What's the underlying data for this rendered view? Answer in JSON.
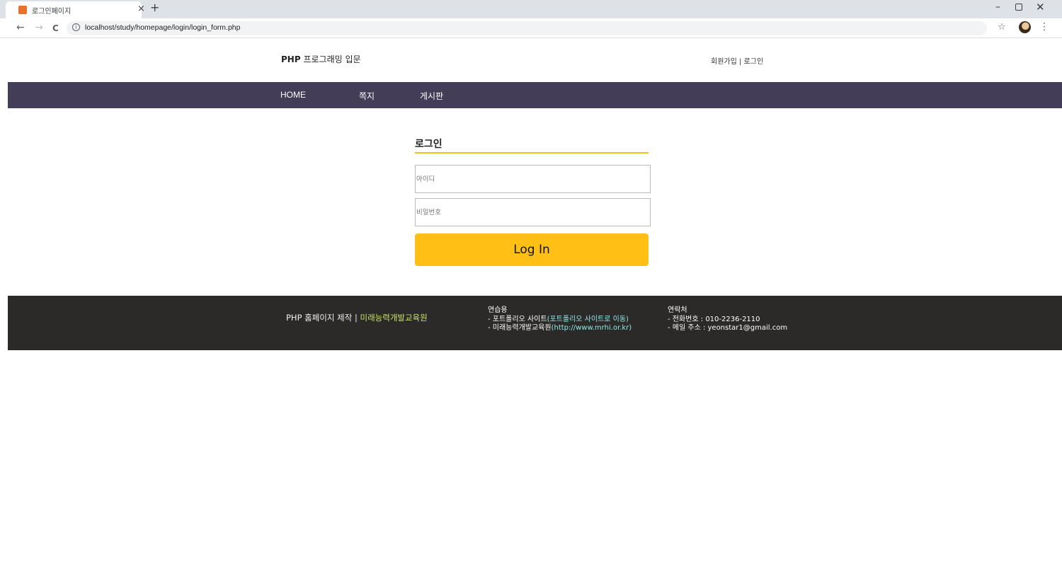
{
  "browser": {
    "tab_title": "로그인페이지",
    "tab_close": "×",
    "new_tab": "+",
    "url": "localhost/study/homepage/login/login_form.php",
    "back_glyph": "←",
    "forward_glyph": "→",
    "reload_glyph": "C",
    "info_glyph": "i",
    "star_glyph": "☆",
    "menu_glyph": "⋮",
    "min_glyph": "–",
    "close_glyph": "✕",
    "icons": [
      "back-arrow-icon",
      "forward-arrow-icon",
      "reload-icon",
      "info-icon",
      "star-icon",
      "profile-avatar",
      "kebab-menu-icon"
    ]
  },
  "header": {
    "site_title_bold": "PHP",
    "site_title_rest": " 프로그래밍 입문",
    "signup": "회원가입",
    "separator": " | ",
    "login": "로그인"
  },
  "menu": {
    "items": [
      "HOME",
      "쪽지",
      "게시판"
    ],
    "bg_color": "#433d57"
  },
  "login": {
    "title": "로그인",
    "id_placeholder": "아이디",
    "pw_placeholder": "비밀번호",
    "button": "Log In",
    "accent_color": "#ffbf15"
  },
  "footer": {
    "main": "PHP 홈페이지 제작 | ",
    "main_accent": "미래능력개발교육원",
    "col1": {
      "heading": "연습용",
      "line1": "- 포트폴리오 사이트",
      "line1_link": "(포트폴리오 사이트로 이동)",
      "line2": "- 미래능력개발교육원",
      "line2_link": "(http://www.mrhi.or.kr)"
    },
    "col2": {
      "heading": "연락처",
      "line1": "- 전화번호 : 010-2236-2110",
      "line2": "- 메일 주소 : yeonstar1@gmail.com"
    },
    "bg_color": "#2b2a28"
  }
}
